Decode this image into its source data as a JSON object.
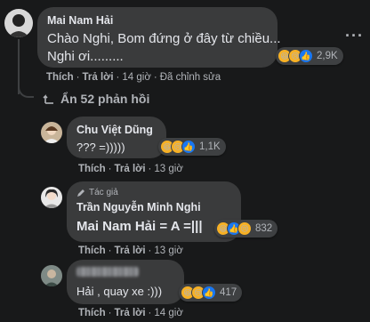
{
  "comments": {
    "main": {
      "author": "Mai Nam Hải",
      "text_line1": "Chào Nghi, Bom đứng ở đây từ chiều...",
      "text_line2": "Nghi ơi.........",
      "reactions": {
        "icons": [
          "haha-icon",
          "sad-icon",
          "like-icon"
        ],
        "count": "2,9K"
      },
      "actions": {
        "like": "Thích",
        "reply": "Trả lời",
        "time": "14 giờ",
        "edited": "Đã chỉnh sửa"
      }
    },
    "hide_replies": "Ẩn 52 phản hồi",
    "replies": [
      {
        "author": "Chu Việt Dũng",
        "text": "??? =)))))",
        "reactions": {
          "count": "1,1K"
        },
        "actions": {
          "like": "Thích",
          "reply": "Trả lời",
          "time": "13 giờ"
        }
      },
      {
        "badge": "Tác giả",
        "author": "Trần Nguyễn Minh Nghi",
        "text": "Mai Nam Hải = A =|||",
        "reactions": {
          "count": "832"
        },
        "actions": {
          "like": "Thích",
          "reply": "Trả lời",
          "time": "13 giờ"
        }
      },
      {
        "author": "",
        "text": "Hải , quay xe :)))",
        "reactions": {
          "count": "417"
        },
        "actions": {
          "like": "Thích",
          "reply": "Trả lời",
          "time": "14 giờ"
        }
      }
    ]
  },
  "more_options": "···"
}
